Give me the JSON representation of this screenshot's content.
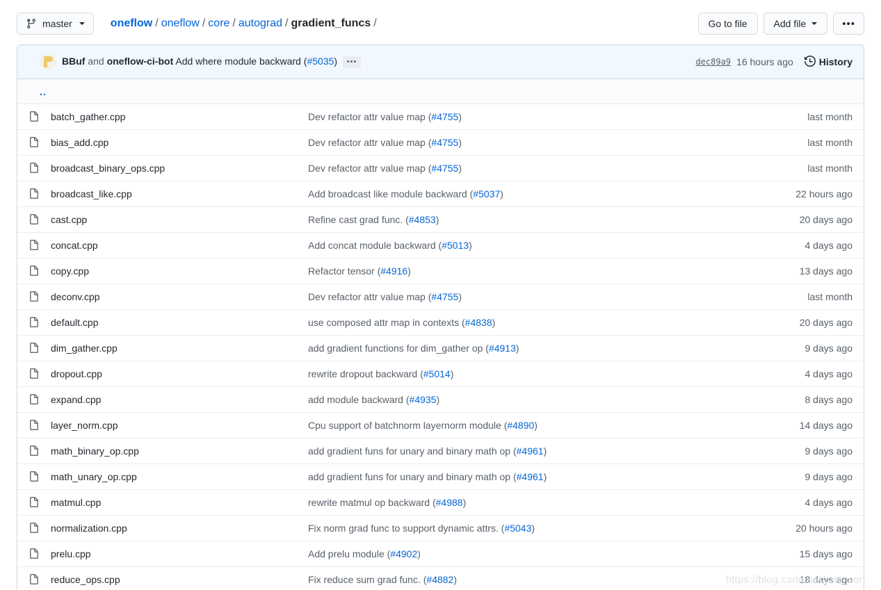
{
  "toolbar": {
    "branch_label": "master",
    "branch_icon": "git-branch-icon",
    "breadcrumb": [
      {
        "label": "oneflow",
        "link": true,
        "strong": true
      },
      {
        "label": "oneflow",
        "link": true,
        "strong": false
      },
      {
        "label": "core",
        "link": true,
        "strong": false
      },
      {
        "label": "autograd",
        "link": true,
        "strong": false
      },
      {
        "label": "gradient_funcs",
        "link": false,
        "strong": true
      }
    ],
    "breadcrumb_separator": "/",
    "breadcrumb_trailing": "/",
    "go_to_file_label": "Go to file",
    "add_file_label": "Add file",
    "more_label": "•••"
  },
  "commit": {
    "authors": [
      "BBuf",
      "oneflow-ci-bot"
    ],
    "author_join": "and",
    "message": "Add where module backward",
    "pr": "#5035",
    "expand_label": "•••",
    "sha": "dec89a9",
    "date": "16 hours ago",
    "history_label": "History",
    "history_icon": "history-clock-icon"
  },
  "table": {
    "parent_dir_label": "..",
    "file_icon": "file-icon",
    "rows": [
      {
        "name": "batch_gather.cpp",
        "msg": "Dev refactor attr value map (",
        "pr": "#4755",
        "msg_end": ")",
        "time": "last month"
      },
      {
        "name": "bias_add.cpp",
        "msg": "Dev refactor attr value map (",
        "pr": "#4755",
        "msg_end": ")",
        "time": "last month"
      },
      {
        "name": "broadcast_binary_ops.cpp",
        "msg": "Dev refactor attr value map (",
        "pr": "#4755",
        "msg_end": ")",
        "time": "last month"
      },
      {
        "name": "broadcast_like.cpp",
        "msg": "Add broadcast like module backward (",
        "pr": "#5037",
        "msg_end": ")",
        "time": "22 hours ago"
      },
      {
        "name": "cast.cpp",
        "msg": "Refine cast grad func. (",
        "pr": "#4853",
        "msg_end": ")",
        "time": "20 days ago"
      },
      {
        "name": "concat.cpp",
        "msg": "Add concat module backward (",
        "pr": "#5013",
        "msg_end": ")",
        "time": "4 days ago"
      },
      {
        "name": "copy.cpp",
        "msg": "Refactor tensor (",
        "pr": "#4916",
        "msg_end": ")",
        "time": "13 days ago"
      },
      {
        "name": "deconv.cpp",
        "msg": "Dev refactor attr value map (",
        "pr": "#4755",
        "msg_end": ")",
        "time": "last month"
      },
      {
        "name": "default.cpp",
        "msg": "use composed attr map in contexts (",
        "pr": "#4838",
        "msg_end": ")",
        "time": "20 days ago"
      },
      {
        "name": "dim_gather.cpp",
        "msg": "add gradient functions for dim_gather op (",
        "pr": "#4913",
        "msg_end": ")",
        "time": "9 days ago"
      },
      {
        "name": "dropout.cpp",
        "msg": "rewrite dropout backward (",
        "pr": "#5014",
        "msg_end": ")",
        "time": "4 days ago"
      },
      {
        "name": "expand.cpp",
        "msg": "add module backward (",
        "pr": "#4935",
        "msg_end": ")",
        "time": "8 days ago"
      },
      {
        "name": "layer_norm.cpp",
        "msg": "Cpu support of batchnorm layernorm module (",
        "pr": "#4890",
        "msg_end": ")",
        "time": "14 days ago"
      },
      {
        "name": "math_binary_op.cpp",
        "msg": "add gradient funs for unary and binary math op (",
        "pr": "#4961",
        "msg_end": ")",
        "time": "9 days ago"
      },
      {
        "name": "math_unary_op.cpp",
        "msg": "add gradient funs for unary and binary math op (",
        "pr": "#4961",
        "msg_end": ")",
        "time": "9 days ago"
      },
      {
        "name": "matmul.cpp",
        "msg": "rewrite matmul op backward (",
        "pr": "#4988",
        "msg_end": ")",
        "time": "4 days ago"
      },
      {
        "name": "normalization.cpp",
        "msg": "Fix norm grad func to support dynamic attrs. (",
        "pr": "#5043",
        "msg_end": ")",
        "time": "20 hours ago"
      },
      {
        "name": "prelu.cpp",
        "msg": "Add prelu module (",
        "pr": "#4902",
        "msg_end": ")",
        "time": "15 days ago"
      },
      {
        "name": "reduce_ops.cpp",
        "msg": "Fix reduce sum grad func. (",
        "pr": "#4882",
        "msg_end": ")",
        "time": "18 days ago"
      }
    ]
  },
  "watermark": {
    "text": "https://blog.csdn.net/just_sort"
  },
  "colors": {
    "link": "#0366d6",
    "text": "#24292e",
    "muted": "#586069",
    "border": "#d1d5da",
    "row_border": "#eaecef",
    "commit_bg": "#f1f8ff",
    "updir_bg": "#fafbfc"
  }
}
